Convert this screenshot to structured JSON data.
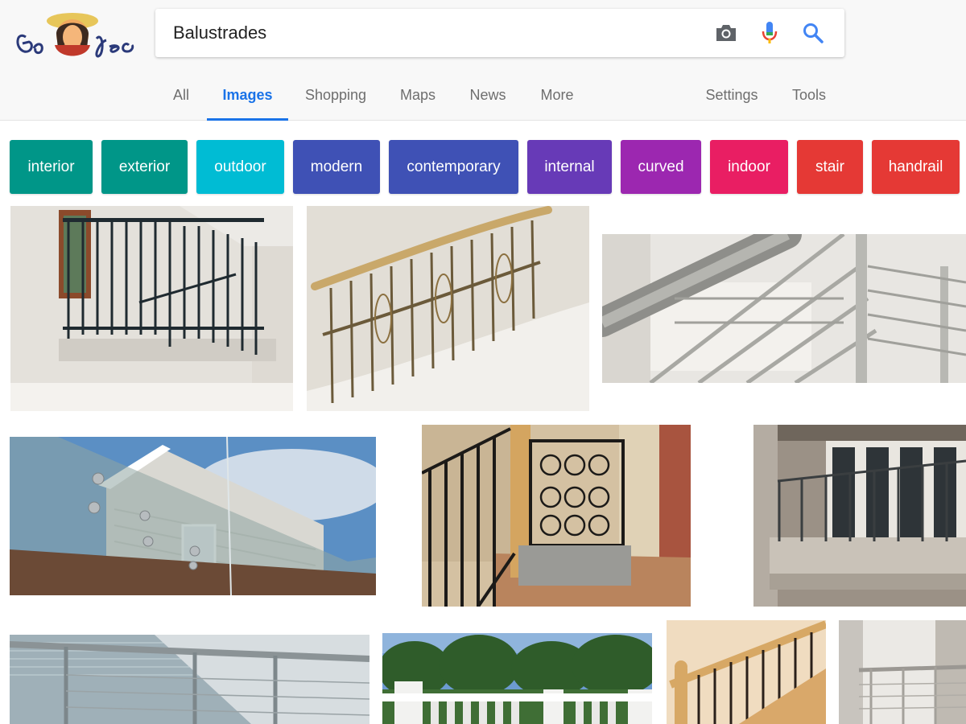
{
  "search": {
    "query": "Balustrades"
  },
  "tabs": [
    "All",
    "Images",
    "Shopping",
    "Maps",
    "News",
    "More"
  ],
  "active_tab": "Images",
  "right_tabs": [
    "Settings",
    "Tools"
  ],
  "chips": [
    {
      "label": "interior",
      "color": "#009688"
    },
    {
      "label": "exterior",
      "color": "#009688"
    },
    {
      "label": "outdoor",
      "color": "#00bcd4"
    },
    {
      "label": "modern",
      "color": "#3f51b5"
    },
    {
      "label": "contemporary",
      "color": "#3f51b5"
    },
    {
      "label": "internal",
      "color": "#673ab7"
    },
    {
      "label": "curved",
      "color": "#9c27b0"
    },
    {
      "label": "indoor",
      "color": "#e91e63"
    },
    {
      "label": "stair",
      "color": "#e53935"
    },
    {
      "label": "handrail",
      "color": "#e53935"
    }
  ],
  "icons": {
    "camera": "camera-icon",
    "mic": "microphone-icon",
    "search": "search-icon"
  },
  "colors": {
    "accent": "#1a73e8",
    "tab_text": "#6e6e6e"
  }
}
